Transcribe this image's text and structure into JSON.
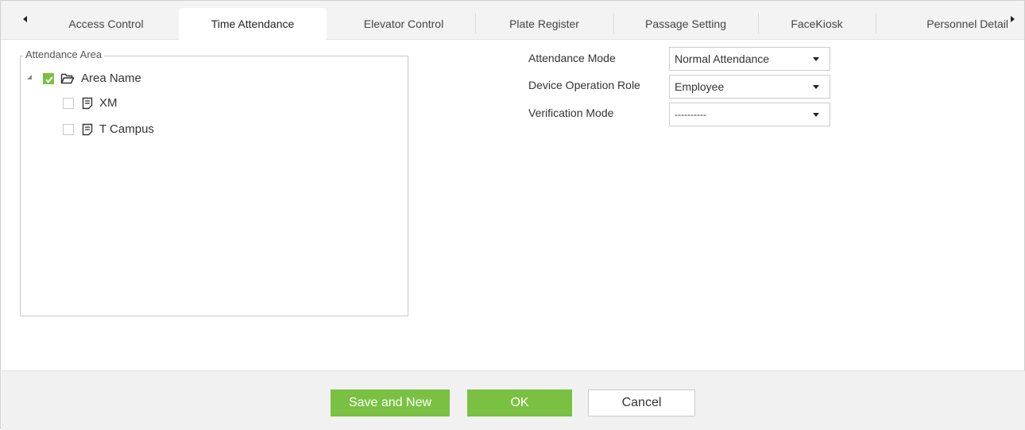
{
  "tabs": [
    {
      "label": "Access Control",
      "active": false
    },
    {
      "label": "Time Attendance",
      "active": true
    },
    {
      "label": "Elevator Control",
      "active": false
    },
    {
      "label": "Plate Register",
      "active": false
    },
    {
      "label": "Passage Setting",
      "active": false
    },
    {
      "label": "FaceKiosk",
      "active": false
    },
    {
      "label": "Personnel Detail",
      "active": false
    }
  ],
  "attendance_area": {
    "legend": "Attendance Area",
    "tree": {
      "root": {
        "label": "Area Name",
        "checked": true,
        "icon": "folder-open-icon"
      },
      "children": [
        {
          "label": "XM",
          "checked": false,
          "icon": "document-icon"
        },
        {
          "label": "T Campus",
          "checked": false,
          "icon": "document-icon"
        }
      ]
    }
  },
  "form": {
    "attendance_mode": {
      "label": "Attendance Mode",
      "value": "Normal Attendance"
    },
    "device_operation_role": {
      "label": "Device Operation Role",
      "value": "Employee"
    },
    "verification_mode": {
      "label": "Verification Mode",
      "value": "----------"
    }
  },
  "buttons": {
    "save_and_new": "Save and New",
    "ok": "OK",
    "cancel": "Cancel"
  },
  "colors": {
    "accent_green": "#7ac143",
    "tab_bar": "#f3f3f3",
    "footer": "#f1f1f1"
  }
}
